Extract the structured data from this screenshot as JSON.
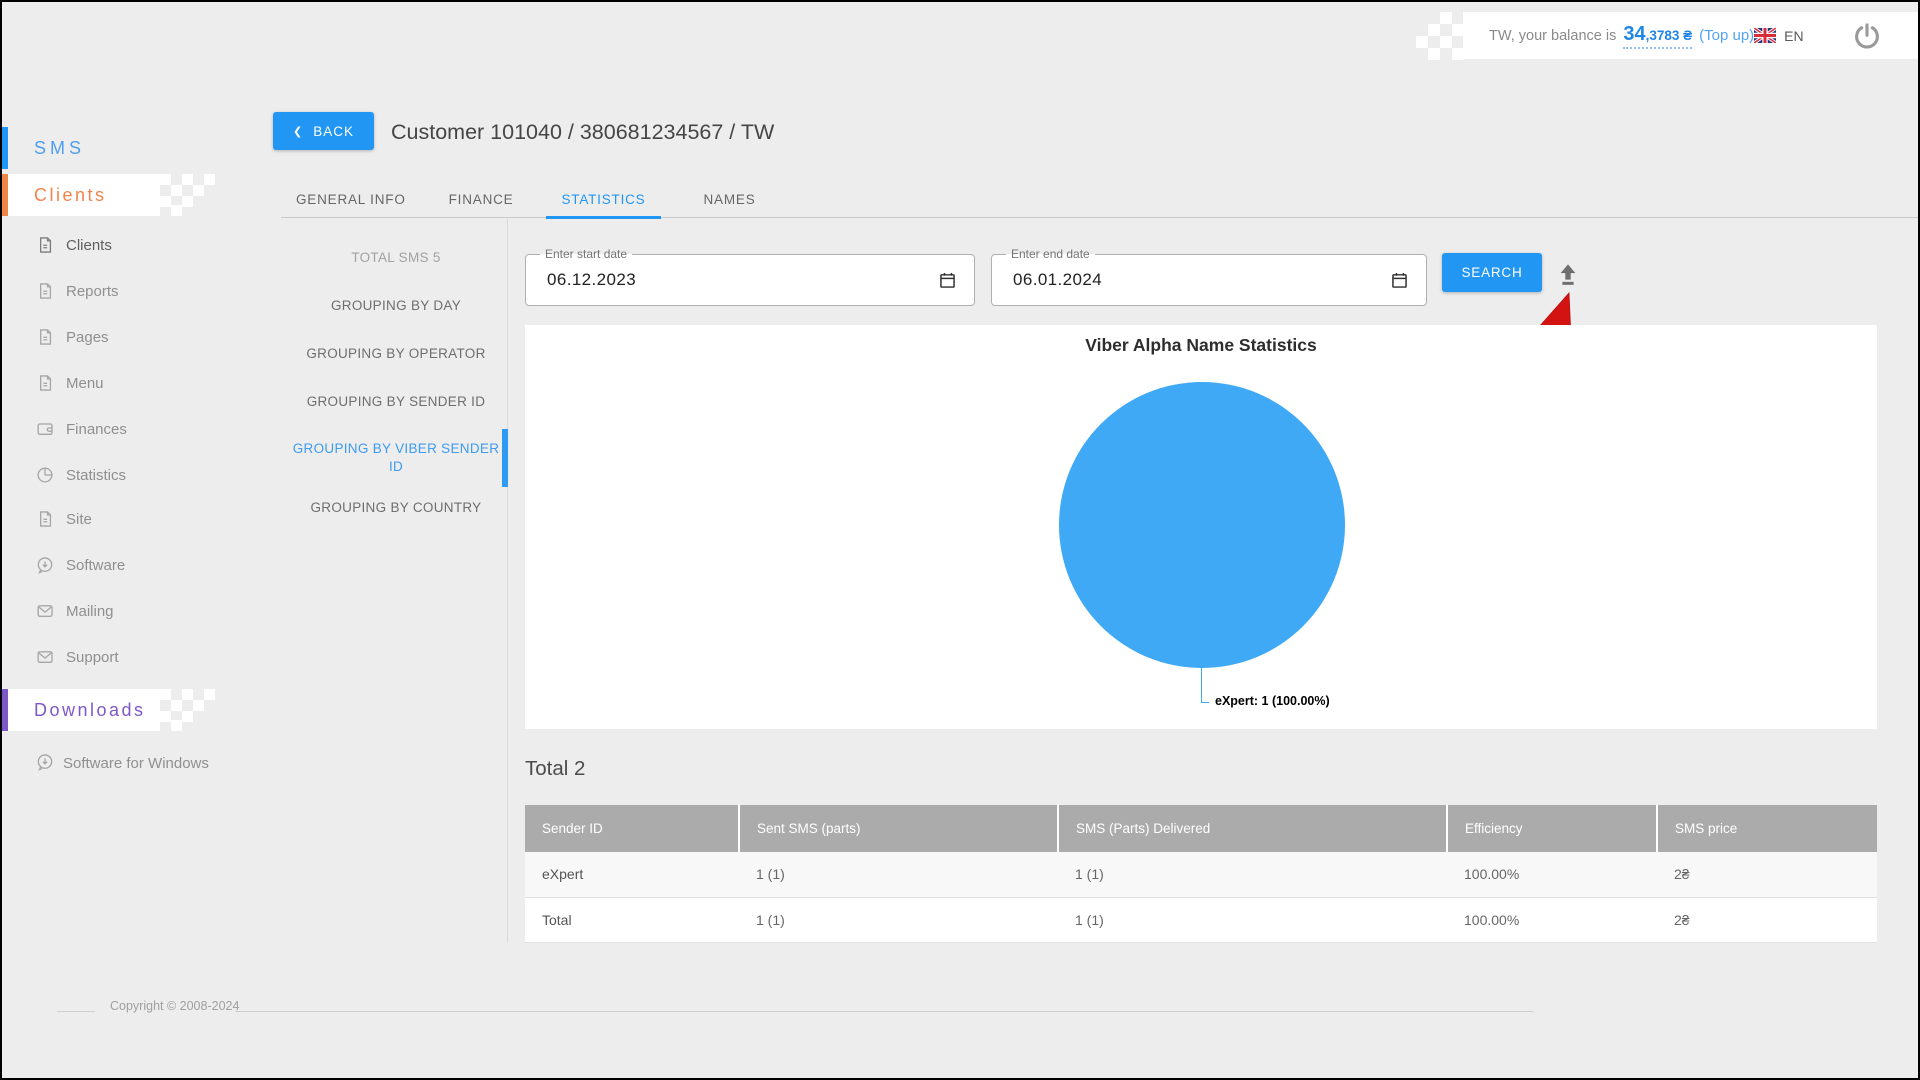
{
  "app": {
    "accent_color": "#2196F3"
  },
  "topbar": {
    "balance_prefix": "TW, your balance is",
    "balance_whole": "34",
    "balance_fraction": ",3783 ₴",
    "topup_label": "(Top up)",
    "language": "EN"
  },
  "sidebar": {
    "sections": [
      {
        "label": "SMS",
        "color": "#4D9EF0"
      },
      {
        "label": "Clients",
        "color": "#F0854B"
      },
      {
        "label": "Downloads",
        "color": "#7E57C8"
      }
    ],
    "clients_items": [
      {
        "label": "Clients",
        "icon": "document-icon"
      },
      {
        "label": "Reports",
        "icon": "document-icon"
      },
      {
        "label": "Pages",
        "icon": "document-icon"
      },
      {
        "label": "Menu",
        "icon": "document-icon"
      },
      {
        "label": "Finances",
        "icon": "wallet-icon"
      },
      {
        "label": "Statistics",
        "icon": "pie-chart-icon"
      },
      {
        "label": "Site",
        "icon": "document-icon"
      },
      {
        "label": "Software",
        "icon": "download-icon"
      },
      {
        "label": "Mailing",
        "icon": "envelope-icon"
      },
      {
        "label": "Support",
        "icon": "envelope-icon"
      }
    ],
    "downloads_items": [
      {
        "label": "Software for Windows",
        "icon": "download-icon"
      }
    ]
  },
  "page_header": {
    "back_label": "BACK",
    "title": "Customer 101040 / 380681234567 / TW"
  },
  "tabs": [
    {
      "label": "GENERAL INFO",
      "active": false
    },
    {
      "label": "FINANCE",
      "active": false
    },
    {
      "label": "STATISTICS",
      "active": true
    },
    {
      "label": "NAMES",
      "active": false
    }
  ],
  "stats_nav": {
    "total_label": "TOTAL SMS 5",
    "items": [
      {
        "label": "GROUPING BY DAY",
        "active": false
      },
      {
        "label": "GROUPING BY OPERATOR",
        "active": false
      },
      {
        "label": "GROUPING BY SENDER ID",
        "active": false
      },
      {
        "label": "GROUPING BY VIBER SENDER ID",
        "active": true
      },
      {
        "label": "GROUPING BY COUNTRY",
        "active": false
      }
    ]
  },
  "filters": {
    "start_date": {
      "label": "Enter start date",
      "value": "06.12.2023"
    },
    "end_date": {
      "label": "Enter end date",
      "value": "06.01.2024"
    },
    "search_label": "SEARCH",
    "export_icon": "upload-icon"
  },
  "chart_data": {
    "type": "pie",
    "title": "Viber Alpha Name Statistics",
    "series": [
      {
        "name": "eXpert",
        "value": 1,
        "percent": 100.0
      }
    ],
    "slice_label": "eXpert: 1 (100.00%)",
    "color": "#3FA9F5",
    "legend": "none"
  },
  "results": {
    "total_label": "Total 2",
    "table": {
      "headers": [
        "Sender ID",
        "Sent SMS (parts)",
        "SMS (Parts) Delivered",
        "Efficiency",
        "SMS price"
      ],
      "rows": [
        [
          "eXpert",
          "1 (1)",
          "1 (1)",
          "100.00%",
          "2₴"
        ],
        [
          "Total",
          "1 (1)",
          "1 (1)",
          "100.00%",
          "2₴"
        ]
      ]
    }
  },
  "footer": {
    "copyright": "Copyright © 2008-2024"
  }
}
